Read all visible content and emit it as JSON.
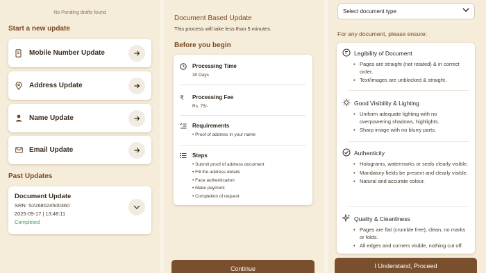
{
  "drafts": {
    "empty_text": "No Pending drafts found"
  },
  "start": {
    "title": "Start a new update",
    "items": [
      {
        "label": "Mobile Number Update",
        "icon": "phone-doc-icon"
      },
      {
        "label": "Address Update",
        "icon": "location-pin-icon"
      },
      {
        "label": "Name Update",
        "icon": "person-icon"
      },
      {
        "label": "Email Update",
        "icon": "envelope-icon"
      }
    ]
  },
  "past": {
    "title": "Past Updates",
    "items": [
      {
        "title": "Document Update",
        "srn": "SRN: S2268024500360",
        "datetime": "2025-09-17 | 13:48:11",
        "status": "Completed"
      }
    ]
  },
  "doc_update": {
    "title": "Document Based Update",
    "subtitle": "This process will take less than 5 minutes.",
    "before_title": "Before you begin",
    "processing_time": {
      "title": "Processing Time",
      "value": "30 Days"
    },
    "processing_fee": {
      "title": "Processing Fee",
      "value": "Rs. 75/-"
    },
    "requirements": {
      "title": "Requirements",
      "items": [
        "Proof of address in your name"
      ]
    },
    "steps": {
      "title": "Steps",
      "items": [
        "Submit proof of address document",
        "Fill the address details",
        "Face authentication",
        "Make payment",
        "Completion of request"
      ]
    },
    "continue_label": "Continue"
  },
  "ensure": {
    "select_placeholder": "Select document type",
    "title": "For any document, please ensure:",
    "groups": [
      {
        "title": "Legibility of Document",
        "items": [
          "Pages are straight (not rotated) & in correct order.",
          "Text/images are unblocked & straight."
        ]
      },
      {
        "title": "Good Visibility & Lighting",
        "items": [
          "Uniform adequate lighting with no overpowering shadows, highlights.",
          "Sharp image with no blurry parts."
        ]
      },
      {
        "title": "Authenticity",
        "items": [
          "Holograms, watermarks or seals clearly visible.",
          "Mandatory fields be present and clearly visible.",
          "Natural and accurate colour."
        ]
      },
      {
        "title": "Quality & Cleanliness",
        "items": [
          "Pages are flat (crumble free), clean, no marks or folds.",
          "All edges and corners visible, nothing cut off."
        ]
      }
    ],
    "proceed_label": "I Understand, Proceed"
  },
  "colors": {
    "accent": "#7a4a26",
    "button": "#7a4f2d",
    "success": "#3c9a55",
    "background": "#f5ecd9"
  }
}
